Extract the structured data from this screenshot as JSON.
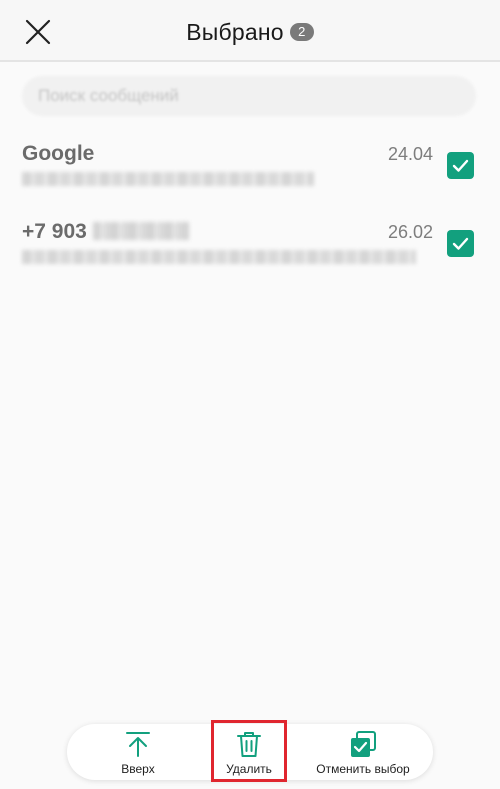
{
  "header": {
    "title": "Выбрано",
    "selected_count": "2",
    "close_icon": "close-icon"
  },
  "search": {
    "placeholder": "Поиск сообщений"
  },
  "messages": [
    {
      "sender": "Google",
      "date": "24.04",
      "checked": true
    },
    {
      "sender": "+7 903",
      "date": "26.02",
      "checked": true
    }
  ],
  "toolbar": {
    "up_label": "Вверх",
    "delete_label": "Удалить",
    "unselect_label": "Отменить выбор"
  },
  "colors": {
    "accent": "#12a07e",
    "highlight": "#e0262f"
  }
}
